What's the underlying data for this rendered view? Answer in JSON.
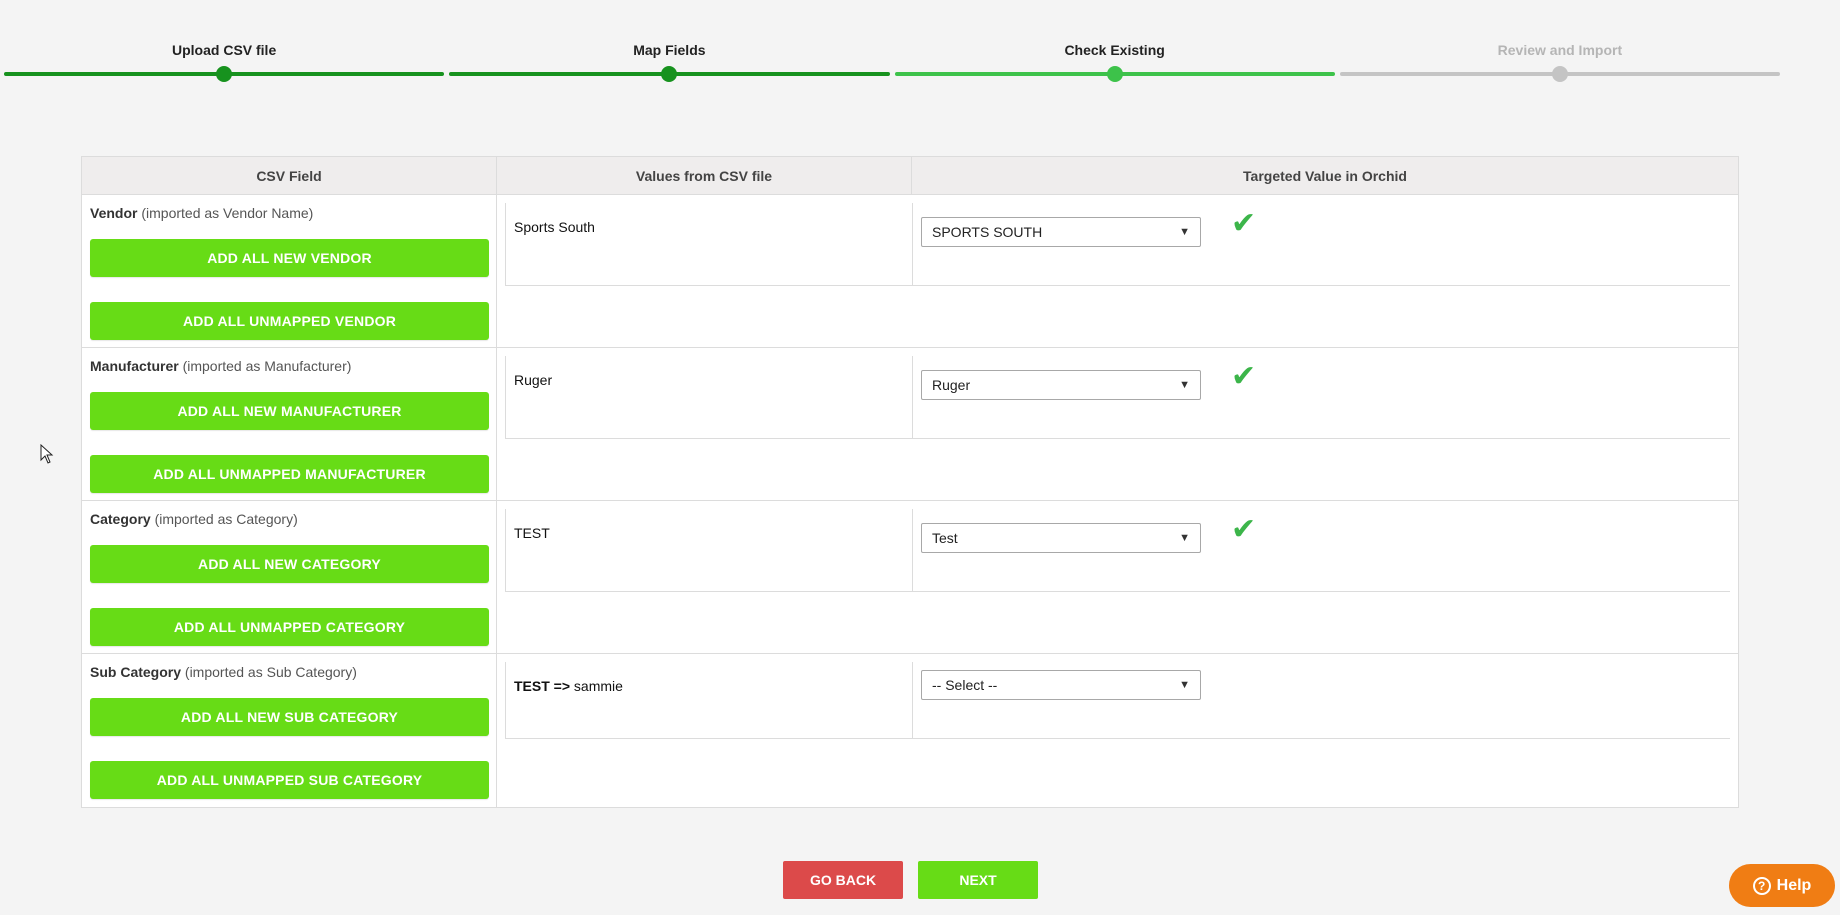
{
  "stepper": {
    "steps": [
      {
        "label": "Upload CSV file",
        "state": "done"
      },
      {
        "label": "Map Fields",
        "state": "done"
      },
      {
        "label": "Check Existing",
        "state": "current"
      },
      {
        "label": "Review and Import",
        "state": "pending"
      }
    ]
  },
  "table": {
    "headers": {
      "csv_field": "CSV Field",
      "values": "Values from CSV file",
      "target": "Targeted Value in Orchid"
    },
    "rows": [
      {
        "field": "Vendor",
        "imported_as": "(imported as Vendor Name)",
        "btn_new": "ADD ALL NEW VENDOR",
        "btn_unmapped": "ADD ALL UNMAPPED VENDOR",
        "csv_value": "Sports South",
        "target_value": "SPORTS SOUTH",
        "mapped_icon": "✔"
      },
      {
        "field": "Manufacturer",
        "imported_as": "(imported as Manufacturer)",
        "btn_new": "ADD ALL NEW MANUFACTURER",
        "btn_unmapped": "ADD ALL UNMAPPED MANUFACTURER",
        "csv_value": "Ruger",
        "target_value": "Ruger",
        "mapped_icon": "✔"
      },
      {
        "field": "Category",
        "imported_as": "(imported as Category)",
        "btn_new": "ADD ALL NEW CATEGORY",
        "btn_unmapped": "ADD ALL UNMAPPED CATEGORY",
        "csv_value": "TEST",
        "target_value": "Test",
        "mapped_icon": "✔"
      },
      {
        "field": "Sub Category",
        "imported_as": "(imported as Sub Category)",
        "btn_new": "ADD ALL NEW SUB CATEGORY",
        "btn_unmapped": "ADD ALL UNMAPPED SUB CATEGORY",
        "csv_parent": "TEST",
        "csv_arrow": "=>",
        "csv_child": "sammie",
        "target_value": "-- Select --"
      }
    ]
  },
  "footer": {
    "back_label": "GO BACK",
    "next_label": "NEXT",
    "help_label": "Help",
    "help_glyph": "?"
  },
  "colors": {
    "step_done": "#17921e",
    "step_current": "#3dc24a",
    "step_pending": "#c4c4c4",
    "green_button": "#67dc16",
    "back_button": "#dc4a4a",
    "help_button": "#f07d14",
    "check_icon": "#3cb54a"
  }
}
